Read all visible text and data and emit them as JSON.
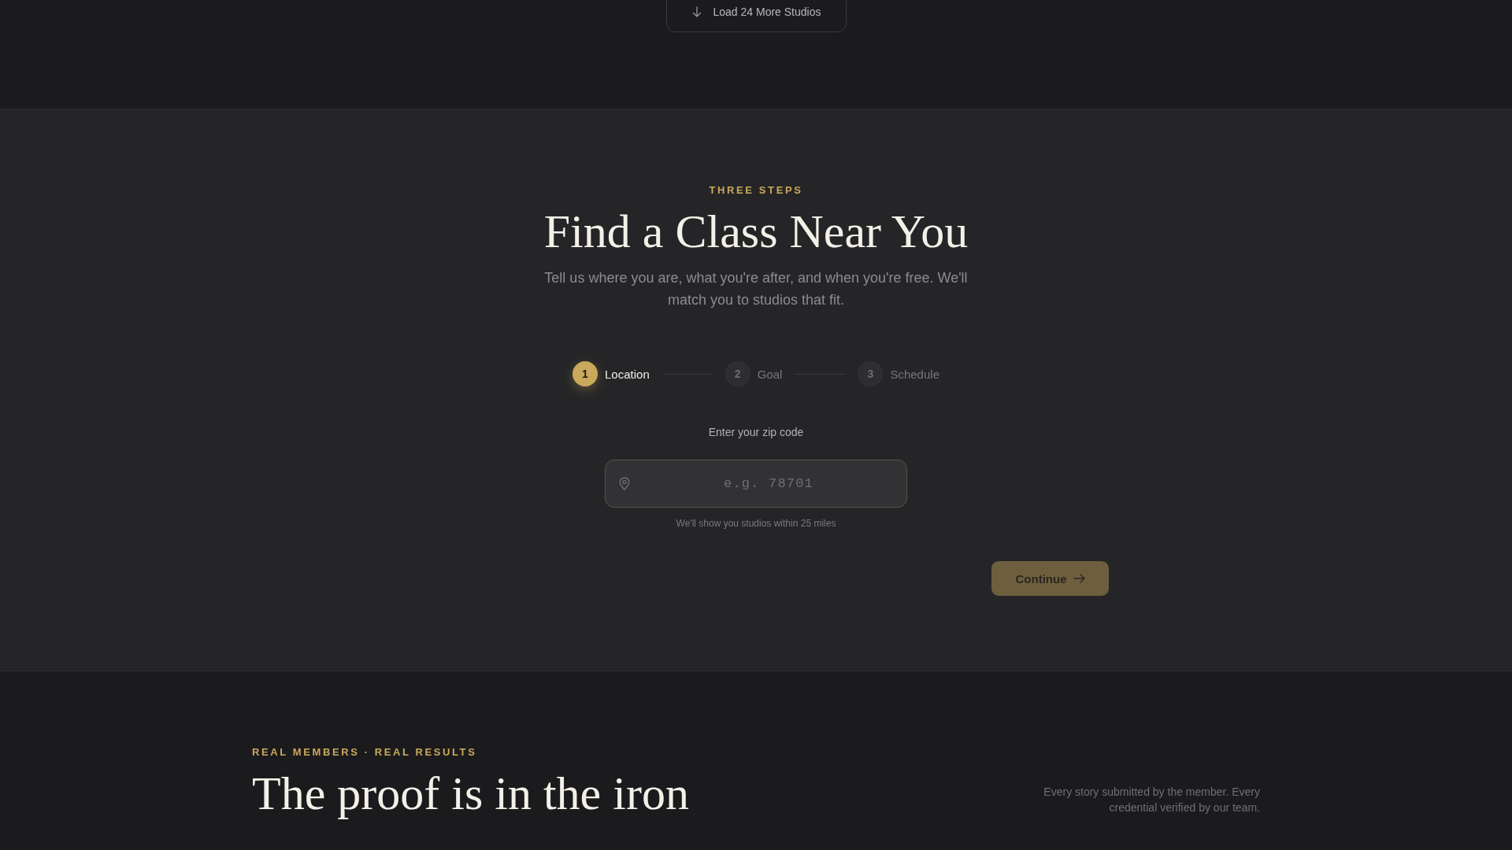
{
  "load_more": {
    "label": "Load 24 More Studios"
  },
  "finder": {
    "eyebrow": "THREE STEPS",
    "title": "Find a Class Near You",
    "subtitle": "Tell us where you are, what you're after, and when you're free. We'll match you to studios that fit.",
    "steps": [
      {
        "number": "1",
        "label": "Location",
        "selected": true
      },
      {
        "number": "2",
        "label": "Goal",
        "selected": false
      },
      {
        "number": "3",
        "label": "Schedule",
        "selected": false
      }
    ],
    "zip": {
      "label": "Enter your zip code",
      "placeholder": "e.g. 78701",
      "hint": "We'll show you studios within 25 miles"
    },
    "continue": {
      "label": "Continue",
      "disabled": true
    }
  },
  "testimonials": {
    "eyebrow": "REAL MEMBERS · REAL RESULTS",
    "title": "The proof is in the iron",
    "note": "Every story submitted by the member. Every credential verified by our team."
  }
}
